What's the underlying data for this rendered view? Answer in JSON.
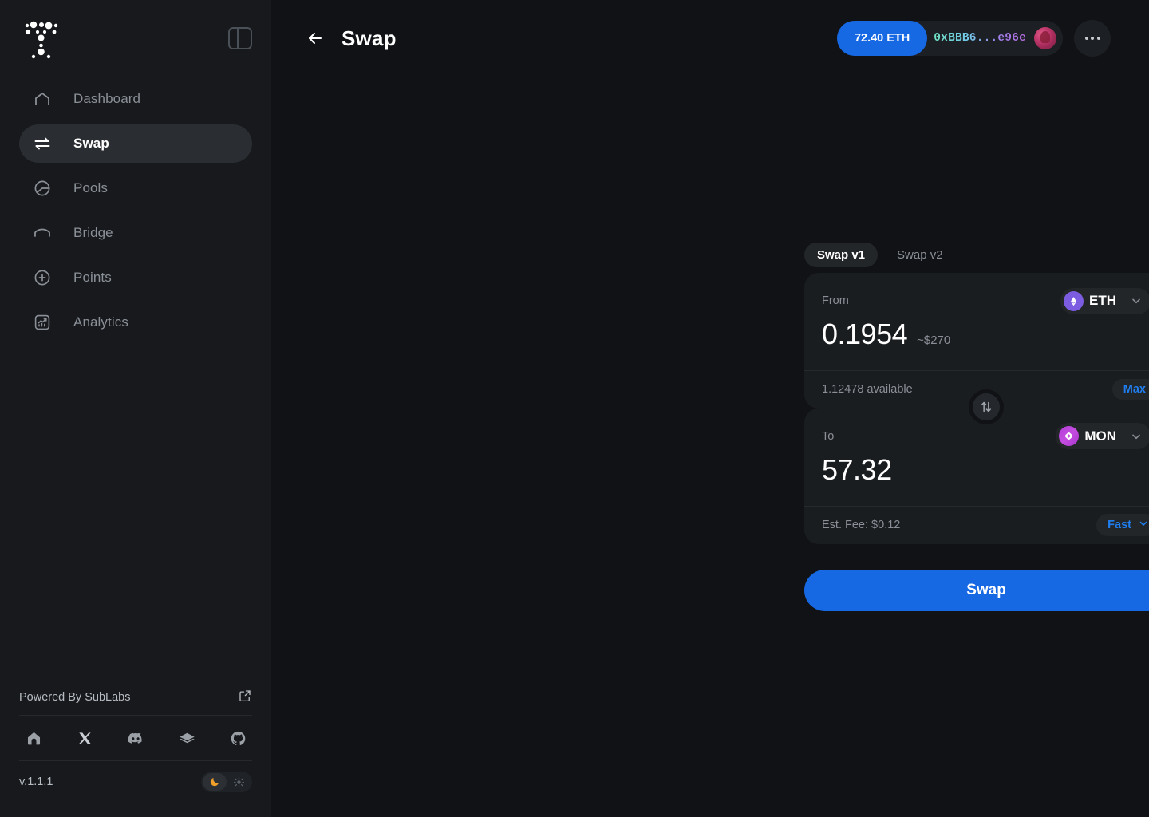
{
  "app": {
    "logo_name": "tsunami-dots-logo",
    "version": "v.1.1.1",
    "powered_by": "Powered By SubLabs"
  },
  "sidebar": {
    "panel_toggle_name": "collapse-sidebar",
    "items": [
      {
        "label": "Dashboard",
        "icon": "home-icon",
        "active": false
      },
      {
        "label": "Swap",
        "icon": "swap-arrows-icon",
        "active": true
      },
      {
        "label": "Pools",
        "icon": "pie-chart-icon",
        "active": false
      },
      {
        "label": "Bridge",
        "icon": "bridge-icon",
        "active": false
      },
      {
        "label": "Points",
        "icon": "plus-circle-icon",
        "active": false
      },
      {
        "label": "Analytics",
        "icon": "analytics-chart-icon",
        "active": false
      }
    ],
    "socials": [
      {
        "name": "website-home-icon"
      },
      {
        "name": "x-twitter-icon"
      },
      {
        "name": "discord-icon"
      },
      {
        "name": "docs-book-icon"
      },
      {
        "name": "github-icon"
      }
    ],
    "theme": {
      "dark_icon": "moon-icon",
      "light_icon": "sun-icon",
      "active": "dark"
    }
  },
  "header": {
    "back_label": "back-arrow",
    "title": "Swap",
    "wallet": {
      "balance": "72.40 ETH",
      "address": "0xBBB6...e96e",
      "avatar_name": "wallet-avatar"
    },
    "more_label": "more-options"
  },
  "swap": {
    "tabs": [
      {
        "label": "Swap v1",
        "active": true
      },
      {
        "label": "Swap v2",
        "active": false
      }
    ],
    "settings_icon": "gear-icon",
    "from": {
      "label": "From",
      "token": "ETH",
      "token_icon": "eth-token-icon",
      "amount": "0.1954",
      "usd": "~$270",
      "available": "1.12478 available",
      "max_label": "Max"
    },
    "toggle_icon": "swap-direction-icon",
    "to": {
      "label": "To",
      "token": "MON",
      "token_icon": "mon-token-icon",
      "amount": "57.32",
      "fee": "Est. Fee: $0.12",
      "speed": "Fast"
    },
    "cta_label": "Swap"
  },
  "colors": {
    "accent_blue": "#1668e3",
    "eth_purple": "#7c5ce0",
    "mon_magenta": "#b43fd8",
    "sidebar_bg": "#17191c",
    "main_bg": "#101215",
    "panel_bg": "#1a1d20"
  }
}
